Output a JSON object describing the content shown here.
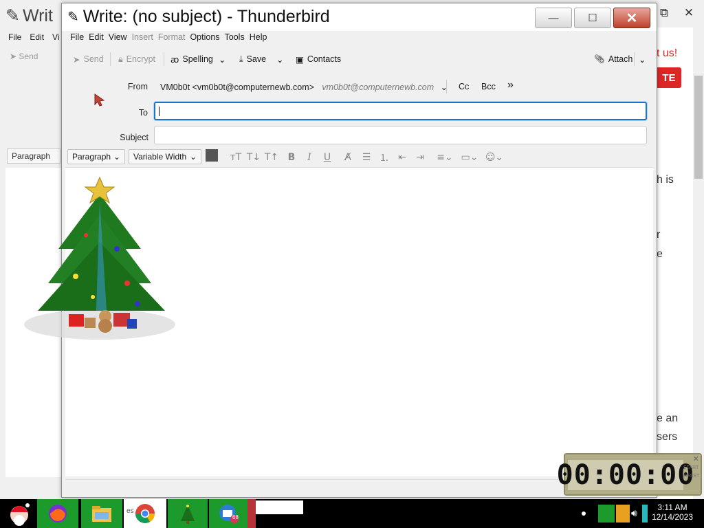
{
  "background_window": {
    "title": "Writ",
    "menu": [
      "File",
      "Edit",
      "Vi"
    ],
    "toolbar": [
      "Send"
    ],
    "paragraph_select": "Paragraph",
    "right_texts": [
      "t us!",
      "TE",
      "h is",
      "r",
      "e",
      "e an",
      "sers"
    ]
  },
  "window": {
    "title": "Write: (no subject) - Thunderbird",
    "controls": {
      "minimize": "—",
      "maximize": "☐",
      "close": "✕"
    }
  },
  "menubar": [
    {
      "label": "File",
      "disabled": false
    },
    {
      "label": "Edit",
      "disabled": false
    },
    {
      "label": "View",
      "disabled": false
    },
    {
      "label": "Insert",
      "disabled": true
    },
    {
      "label": "Format",
      "disabled": true
    },
    {
      "label": "Options",
      "disabled": false
    },
    {
      "label": "Tools",
      "disabled": false
    },
    {
      "label": "Help",
      "disabled": false
    }
  ],
  "toolbar": {
    "send": "Send",
    "encrypt": "Encrypt",
    "spelling": "Spelling",
    "save": "Save",
    "contacts": "Contacts",
    "attach": "Attach"
  },
  "header": {
    "from_label": "From",
    "from_value": "VM0b0t <vm0b0t@computernewb.com>",
    "from_identity": "vm0b0t@computernewb.com",
    "cc": "Cc",
    "bcc": "Bcc",
    "more": "»",
    "to_label": "To",
    "to_value": "",
    "subject_label": "Subject",
    "subject_value": ""
  },
  "format_toolbar": {
    "paragraph": "Paragraph",
    "font": "Variable Width"
  },
  "timer": {
    "display": "00:00:00",
    "side_text": [
      "START",
      "RESET"
    ]
  },
  "taskbar": {
    "time": "3:11 AM",
    "date": "12/14/2023",
    "badge": "68",
    "partial_label": "es"
  },
  "colors": {
    "accent_focus": "#1a73c8",
    "close_button": "#c0412d",
    "red_button": "#dc2626"
  }
}
